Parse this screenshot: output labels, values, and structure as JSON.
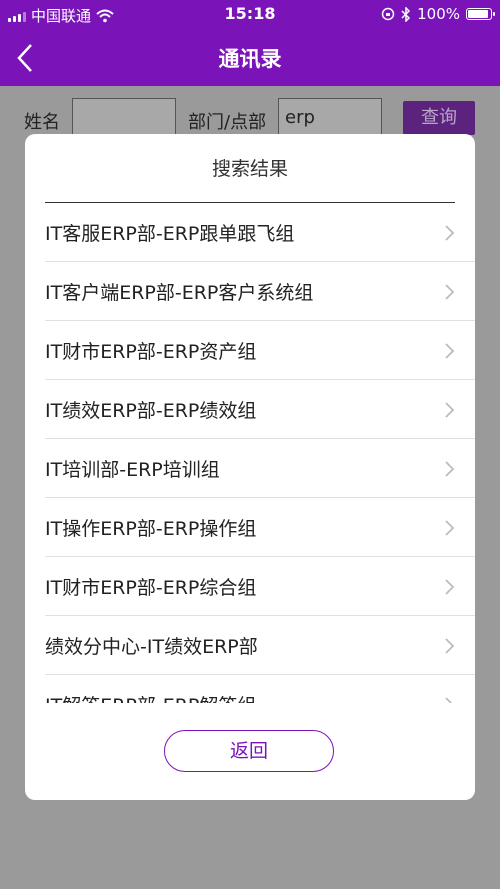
{
  "status_bar": {
    "carrier": "中国联通",
    "time": "15:18",
    "battery_percent": "100%",
    "battery_level": 1.0
  },
  "nav": {
    "title": "通讯录",
    "back_icon": "chevron-left-icon"
  },
  "search": {
    "name_label": "姓名",
    "name_value": "",
    "dept_label": "部门/点部",
    "dept_value": "erp",
    "query_button": "查询"
  },
  "modal": {
    "title": "搜索结果",
    "items": [
      {
        "label": "IT客服ERP部-ERP跟单跟飞组"
      },
      {
        "label": "IT客户端ERP部-ERP客户系统组"
      },
      {
        "label": "IT财市ERP部-ERP资产组"
      },
      {
        "label": "IT绩效ERP部-ERP绩效组"
      },
      {
        "label": "IT培训部-ERP培训组"
      },
      {
        "label": "IT操作ERP部-ERP操作组"
      },
      {
        "label": "IT财市ERP部-ERP综合组"
      },
      {
        "label": "绩效分中心-IT绩效ERP部"
      },
      {
        "label": "IT解答ERP部-ERP解答组"
      }
    ],
    "back_button": "返回"
  },
  "colors": {
    "brand": "#7a14b8",
    "overlay": "#9a9a9a"
  }
}
